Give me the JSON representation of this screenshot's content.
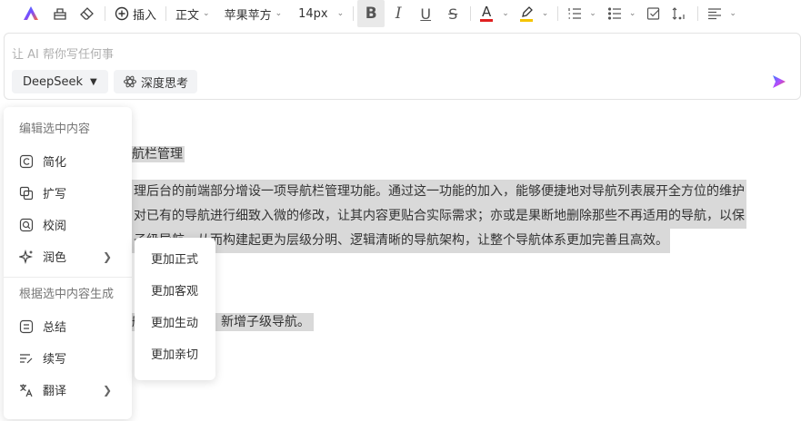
{
  "toolbar": {
    "insert_label": "插入",
    "heading_style": "正文",
    "font_family": "苹果苹方",
    "font_size": "14px",
    "text_color": "#e02020",
    "highlight_color": "#f5c400"
  },
  "ai_panel": {
    "placeholder": "让 AI 帮你写任何事",
    "model": "DeepSeek",
    "deep_think_label": "深度思考"
  },
  "document": {
    "heading_fragment": "航栏管理",
    "para_lines": [
      "理后台的前端部分增设一项导航栏管理功能。通过这一功能的加入，能够便捷地对导航列表展开全方位的维护",
      "对已有的导航进行细致入微的修改，让其内容更贴合实际需求；亦或是果断地删除那些不再适用的导航，以保",
      "子级导航，从而构建起更为层级分明、逻辑清晰的导航架构，让整个导航体系更加完善且高效。"
    ],
    "list_fragment": "航，删除导航，新增子级导航。"
  },
  "edit_menu": {
    "header_edit": "编辑选中内容",
    "items_edit": [
      {
        "label": "简化",
        "icon": "simplify-icon"
      },
      {
        "label": "扩写",
        "icon": "expand-icon"
      },
      {
        "label": "校阅",
        "icon": "proofread-icon"
      },
      {
        "label": "润色",
        "icon": "polish-icon",
        "has_submenu": true
      }
    ],
    "header_generate": "根据选中内容生成",
    "items_generate": [
      {
        "label": "总结",
        "icon": "summary-icon"
      },
      {
        "label": "续写",
        "icon": "continue-icon"
      },
      {
        "label": "翻译",
        "icon": "translate-icon",
        "has_submenu": true
      }
    ]
  },
  "polish_submenu": {
    "items": [
      "更加正式",
      "更加客观",
      "更加生动",
      "更加亲切"
    ]
  }
}
